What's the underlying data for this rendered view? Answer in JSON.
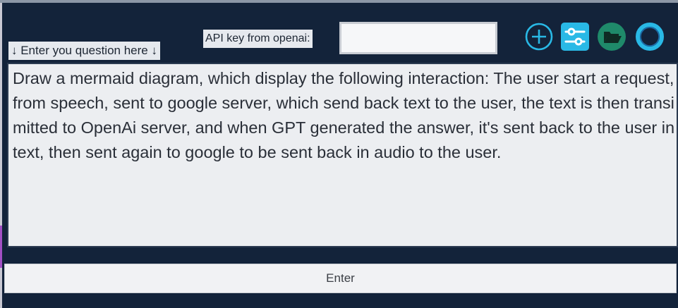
{
  "labels": {
    "question": "↓ Enter you question here ↓",
    "api_key": "API key from openai:"
  },
  "api_key_input": {
    "value": "",
    "placeholder": ""
  },
  "toolbar": {
    "icons": [
      "add-circle-icon",
      "settings-sliders-icon",
      "folder-open-icon",
      "ring-circle-icon"
    ]
  },
  "question": {
    "text": "Draw a mermaid diagram, which display the following interaction: The user start a request, from speech, sent to google server, which send back text to the user, the text is then transimitted to OpenAi server, and when GPT generated the answer, it's sent back to the user in text, then sent again to google to be sent back in audio to the user."
  },
  "enter_button": {
    "label": "Enter"
  },
  "colors": {
    "window_bg": "#13233a",
    "accent_cyan": "#29b9e6",
    "folder_green": "#1f8a6a",
    "field_bg": "#eceef1"
  }
}
